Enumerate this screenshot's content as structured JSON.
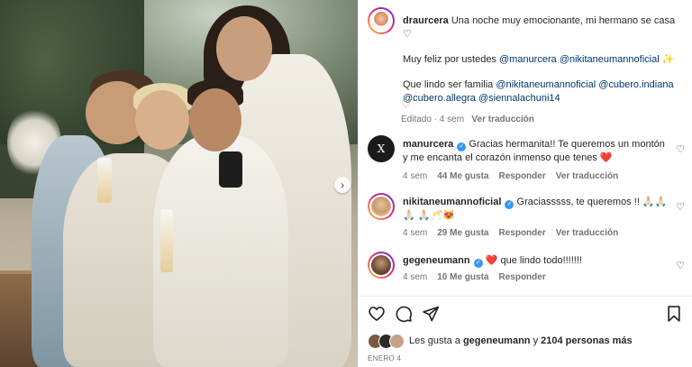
{
  "caption": {
    "username": "draurcera",
    "line1": "Una noche muy emocionante, mi hermano se casa ♡",
    "line2_prefix": "Muy feliz por ustedes ",
    "line2_mentions": [
      "@manurcera",
      "@nikitaneumannoficial"
    ],
    "line2_suffix": " ✨",
    "line3_prefix": "Que lindo ser familia ",
    "line3_mentions": [
      "@nikitaneumannoficial",
      "@cubero.indiana",
      "@cubero.allegra",
      "@siennalachuni14"
    ],
    "meta_edited": "Editado · 4 sem",
    "meta_translate": "Ver traducción"
  },
  "comments": [
    {
      "username": "manurcera",
      "text": "Gracias hermanita!! Te queremos un montón y me encanta el corazón inmenso que tenes ❤️",
      "time": "4 sem",
      "likes": "44 Me gusta",
      "reply": "Responder",
      "translate": "Ver traducción",
      "avatar_color": "#1b1b1b"
    },
    {
      "username": "nikitaneumannoficial",
      "text": "Graciasssss, te queremos !! 🙏🏻🙏🏻🙏🏻 🙏🏻🥂😻",
      "time": "4 sem",
      "likes": "29 Me gusta",
      "reply": "Responder",
      "translate": "Ver traducción",
      "avatar_color": "#e4c8a4"
    },
    {
      "username": "gegeneumann",
      "text": "❤️ que lindo todo!!!!!!!",
      "time": "4 sem",
      "likes": "10 Me gusta",
      "reply": "Responder",
      "avatar_color": "#8a6a52"
    }
  ],
  "likes": {
    "prefix": "Les gusta a ",
    "user": "gegeneumann",
    "middle": " y ",
    "count": "2104 personas más"
  },
  "date": "ENERO 4",
  "icons": {
    "like": "heart-icon",
    "comment": "comment-icon",
    "share": "share-icon",
    "save": "bookmark-icon",
    "next": "chevron-right-icon"
  },
  "colors": {
    "mention": "#00376b",
    "verified": "#3897f0",
    "heart_red": "#ed4956"
  }
}
